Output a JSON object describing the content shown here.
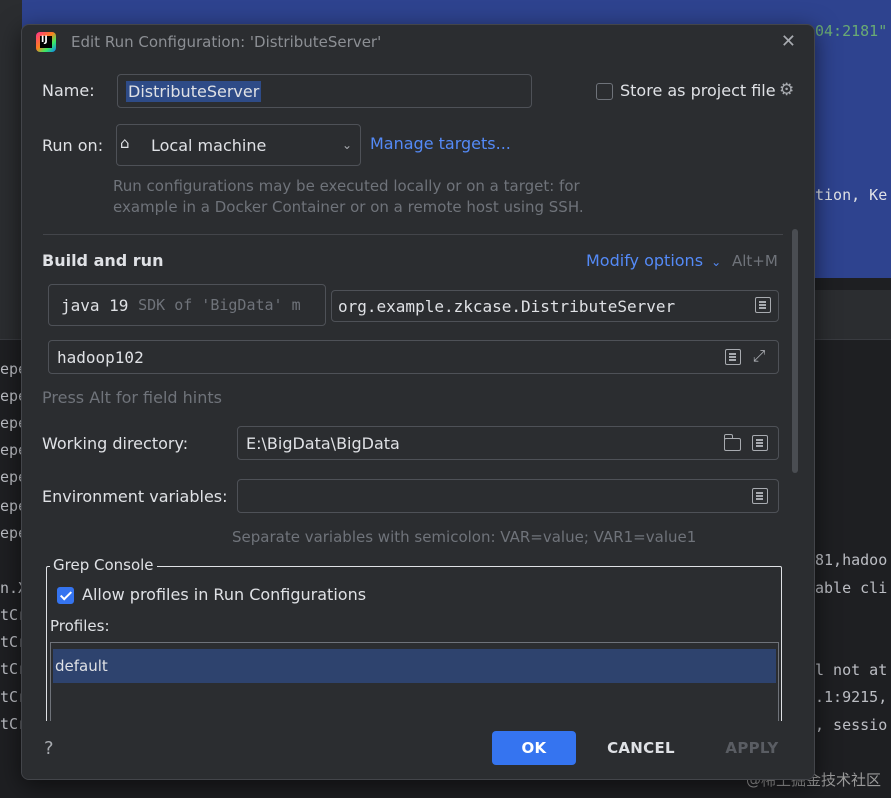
{
  "background": {
    "editor_fragment_1": "04:2181\"",
    "editor_fragment_2": "tion, Ke",
    "console_right": [
      "81,hadoo",
      "able cli",
      "",
      "l not at",
      ".1:9215,",
      ", sessio"
    ],
    "console_left": [
      "epe",
      "epe",
      "epe",
      "epe",
      "epe",
      "epe",
      "epe",
      "n.X",
      "tCr",
      "tCr",
      "tCr",
      "tCr",
      "tCr"
    ],
    "watermark": "@稀土掘金技术社区"
  },
  "dialog": {
    "title": "Edit Run Configuration: 'DistributeServer'",
    "name_label": "Name:",
    "name_value": "DistributeServer",
    "store_label": "Store as project file",
    "store_checked": false,
    "run_on_label": "Run on:",
    "run_on_value": "Local machine",
    "manage_targets": "Manage targets...",
    "run_on_hint_line1": "Run configurations may be executed locally or on a target: for",
    "run_on_hint_line2": "example in a Docker Container or on a remote host using SSH.",
    "build_and_run": "Build and run",
    "modify_options": "Modify options",
    "modify_shortcut": "Alt+M",
    "sdk_value": "java 19",
    "sdk_detail": "SDK of 'BigData' m",
    "main_class": "org.example.zkcase.DistributeServer",
    "program_args": "hadoop102",
    "field_hint": "Press Alt for field hints",
    "working_dir_label": "Working directory:",
    "working_dir_value": "E:\\BigData\\BigData",
    "env_label": "Environment variables:",
    "env_value": "",
    "env_hint": "Separate variables with semicolon: VAR=value; VAR1=value1",
    "grep_title": "Grep Console",
    "allow_profiles_label": "Allow profiles in Run Configurations",
    "allow_profiles_checked": true,
    "profiles_label": "Profiles:",
    "profiles": [
      "default"
    ],
    "help": "?",
    "ok": "OK",
    "cancel": "CANCEL",
    "apply": "APPLY"
  },
  "colors": {
    "accent": "#3574f0",
    "link": "#548af7",
    "dialog_bg": "#2b2d30",
    "selection": "#2e436e"
  }
}
